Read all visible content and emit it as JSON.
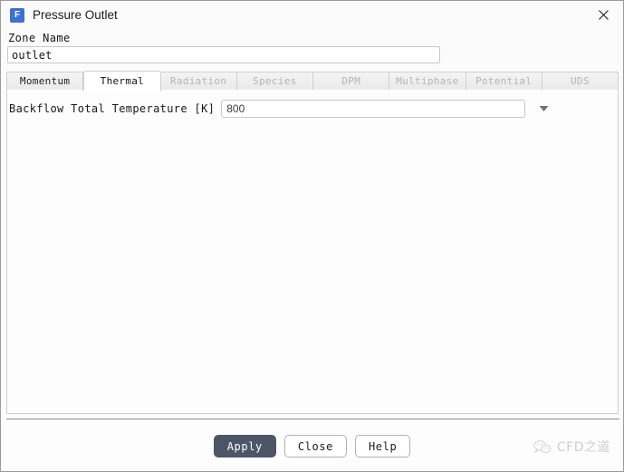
{
  "window": {
    "title": "Pressure Outlet",
    "app_icon_letter": "F",
    "app_icon_color": "#3f6fd1",
    "close_label": "✕"
  },
  "zone": {
    "label": "Zone Name",
    "value": "outlet",
    "placeholder": ""
  },
  "tabs": [
    {
      "label": "Momentum",
      "active": false,
      "enabled": true
    },
    {
      "label": "Thermal",
      "active": true,
      "enabled": true
    },
    {
      "label": "Radiation",
      "active": false,
      "enabled": false
    },
    {
      "label": "Species",
      "active": false,
      "enabled": false
    },
    {
      "label": "DPM",
      "active": false,
      "enabled": false
    },
    {
      "label": "Multiphase",
      "active": false,
      "enabled": false
    },
    {
      "label": "Potential",
      "active": false,
      "enabled": false
    },
    {
      "label": "UDS",
      "active": false,
      "enabled": false
    }
  ],
  "thermal_panel": {
    "field_label": "Backflow Total Temperature [K]",
    "field_value": "800",
    "field_placeholder": "",
    "dropdown_icon": "chevron-down-icon"
  },
  "footer": {
    "apply_label": "Apply",
    "close_label": "Close",
    "help_label": "Help",
    "apply_color": "#4c5667"
  },
  "watermark": {
    "text": "CFD之道",
    "icon": "wechat-icon"
  }
}
